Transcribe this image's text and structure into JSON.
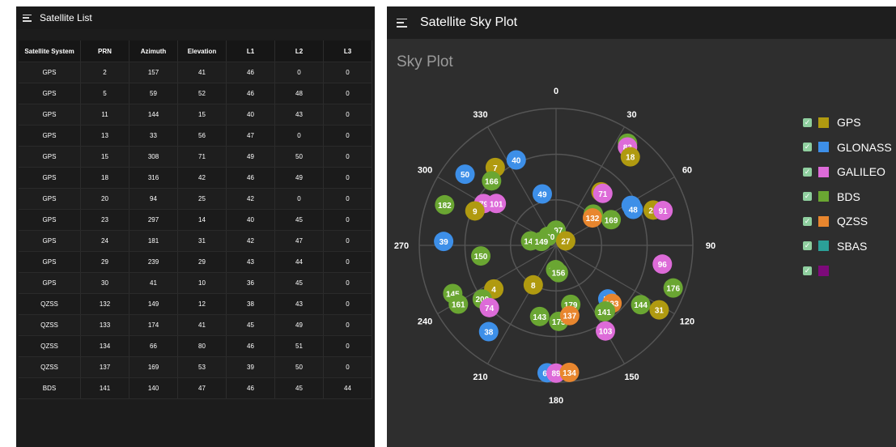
{
  "left": {
    "title": "Satellite List",
    "columns": [
      "Satellite System",
      "PRN",
      "Azimuth",
      "Elevation",
      "L1",
      "L2",
      "L3"
    ],
    "rows": [
      [
        "GPS",
        "2",
        "157",
        "41",
        "46",
        "0",
        "0"
      ],
      [
        "GPS",
        "5",
        "59",
        "52",
        "46",
        "48",
        "0"
      ],
      [
        "GPS",
        "11",
        "144",
        "15",
        "40",
        "43",
        "0"
      ],
      [
        "GPS",
        "13",
        "33",
        "56",
        "47",
        "0",
        "0"
      ],
      [
        "GPS",
        "15",
        "308",
        "71",
        "49",
        "50",
        "0"
      ],
      [
        "GPS",
        "18",
        "316",
        "42",
        "46",
        "49",
        "0"
      ],
      [
        "GPS",
        "20",
        "94",
        "25",
        "42",
        "0",
        "0"
      ],
      [
        "GPS",
        "23",
        "297",
        "14",
        "40",
        "45",
        "0"
      ],
      [
        "GPS",
        "24",
        "181",
        "31",
        "42",
        "47",
        "0"
      ],
      [
        "GPS",
        "29",
        "239",
        "29",
        "43",
        "44",
        "0"
      ],
      [
        "GPS",
        "30",
        "41",
        "10",
        "36",
        "45",
        "0"
      ],
      [
        "QZSS",
        "132",
        "149",
        "12",
        "38",
        "43",
        "0"
      ],
      [
        "QZSS",
        "133",
        "174",
        "41",
        "45",
        "49",
        "0"
      ],
      [
        "QZSS",
        "134",
        "66",
        "80",
        "46",
        "51",
        "0"
      ],
      [
        "QZSS",
        "137",
        "169",
        "53",
        "39",
        "50",
        "0"
      ],
      [
        "BDS",
        "141",
        "140",
        "47",
        "46",
        "45",
        "44"
      ]
    ]
  },
  "right": {
    "title": "Satellite Sky Plot",
    "plot_title": "Sky Plot",
    "legend": [
      {
        "name": "GPS",
        "color": "#b09a10"
      },
      {
        "name": "GLONASS",
        "color": "#3d8fe8"
      },
      {
        "name": "GALILEO",
        "color": "#dd6bd8"
      },
      {
        "name": "BDS",
        "color": "#6aa632"
      },
      {
        "name": "QZSS",
        "color": "#e8862e"
      },
      {
        "name": "SBAS",
        "color": "#2ba098"
      },
      {
        "name": "",
        "color": "#7d0a7a"
      }
    ]
  },
  "chart_data": {
    "type": "scatter",
    "projection": "polar-sky",
    "azimuth_labels": [
      "0",
      "30",
      "60",
      "90",
      "120",
      "150",
      "180",
      "210",
      "240",
      "270",
      "300",
      "330"
    ],
    "satellites": [
      {
        "prn": "197",
        "system": "BDS",
        "azimuth": 0,
        "elevation": 80
      },
      {
        "prn": "40",
        "system": "GLONASS",
        "azimuth": 335,
        "elevation": 28
      },
      {
        "prn": "49",
        "system": "GLONASS",
        "azimuth": 345,
        "elevation": 55
      },
      {
        "prn": "7",
        "system": "GPS",
        "azimuth": 322,
        "elevation": 25
      },
      {
        "prn": "166",
        "system": "BDS",
        "azimuth": 315,
        "elevation": 30
      },
      {
        "prn": "50",
        "system": "GLONASS",
        "azimuth": 308,
        "elevation": 14
      },
      {
        "prn": "83",
        "system": "BDS",
        "azimuth": 35,
        "elevation": 8
      },
      {
        "prn": "83",
        "system": "GALILEO",
        "azimuth": 36,
        "elevation": 10
      },
      {
        "prn": "18",
        "system": "GPS",
        "azimuth": 40,
        "elevation": 14
      },
      {
        "prn": "71",
        "system": "GPS",
        "azimuth": 40,
        "elevation": 44
      },
      {
        "prn": "71",
        "system": "GALILEO",
        "azimuth": 42,
        "elevation": 44
      },
      {
        "prn": "79",
        "system": "GALILEO",
        "azimuth": 300,
        "elevation": 35
      },
      {
        "prn": "101",
        "system": "GALILEO",
        "azimuth": 305,
        "elevation": 42
      },
      {
        "prn": "182",
        "system": "BDS",
        "azimuth": 290,
        "elevation": 12
      },
      {
        "prn": "9",
        "system": "GPS",
        "azimuth": 293,
        "elevation": 32
      },
      {
        "prn": "58",
        "system": "GLONASS",
        "azimuth": 62,
        "elevation": 34
      },
      {
        "prn": "48",
        "system": "GLONASS",
        "azimuth": 65,
        "elevation": 34
      },
      {
        "prn": "26",
        "system": "GPS",
        "azimuth": 70,
        "elevation": 22
      },
      {
        "prn": "91",
        "system": "GALILEO",
        "azimuth": 72,
        "elevation": 16
      },
      {
        "prn": "185",
        "system": "BDS",
        "azimuth": 50,
        "elevation": 58
      },
      {
        "prn": "132",
        "system": "QZSS",
        "azimuth": 53,
        "elevation": 60
      },
      {
        "prn": "169",
        "system": "BDS",
        "azimuth": 65,
        "elevation": 50
      },
      {
        "prn": "180",
        "system": "BDS",
        "azimuth": 318,
        "elevation": 82
      },
      {
        "prn": "147",
        "system": "BDS",
        "azimuth": 280,
        "elevation": 73
      },
      {
        "prn": "149",
        "system": "BDS",
        "azimuth": 285,
        "elevation": 80
      },
      {
        "prn": "27",
        "system": "GPS",
        "azimuth": 65,
        "elevation": 83
      },
      {
        "prn": "39",
        "system": "GLONASS",
        "azimuth": 272,
        "elevation": 16
      },
      {
        "prn": "150",
        "system": "BDS",
        "azimuth": 262,
        "elevation": 40
      },
      {
        "prn": "96",
        "system": "GALILEO",
        "azimuth": 100,
        "elevation": 19
      },
      {
        "prn": "176",
        "system": "BDS",
        "azimuth": 110,
        "elevation": 8
      },
      {
        "prn": "145",
        "system": "BDS",
        "azimuth": 245,
        "elevation": 15
      },
      {
        "prn": "4",
        "system": "GPS",
        "azimuth": 235,
        "elevation": 40
      },
      {
        "prn": "8",
        "system": "GPS",
        "azimuth": 210,
        "elevation": 60
      },
      {
        "prn": "141",
        "system": "BDS",
        "azimuth": 181,
        "elevation": 74
      },
      {
        "prn": "156",
        "system": "BDS",
        "azimuth": 175,
        "elevation": 72
      },
      {
        "prn": "179",
        "system": "BDS",
        "azimuth": 166,
        "elevation": 50
      },
      {
        "prn": "200",
        "system": "BDS",
        "azimuth": 234,
        "elevation": 30
      },
      {
        "prn": "74",
        "system": "GALILEO",
        "azimuth": 227,
        "elevation": 30
      },
      {
        "prn": "161",
        "system": "BDS",
        "azimuth": 239,
        "elevation": 15
      },
      {
        "prn": "143",
        "system": "BDS",
        "azimuth": 193,
        "elevation": 42
      },
      {
        "prn": "175",
        "system": "BDS",
        "azimuth": 178,
        "elevation": 40
      },
      {
        "prn": "137",
        "system": "QZSS",
        "azimuth": 169,
        "elevation": 43
      },
      {
        "prn": "59",
        "system": "GLONASS",
        "azimuth": 136,
        "elevation": 41
      },
      {
        "prn": "133",
        "system": "QZSS",
        "azimuth": 136,
        "elevation": 37
      },
      {
        "prn": "199",
        "system": "BDS",
        "azimuth": 143,
        "elevation": 36
      },
      {
        "prn": "141",
        "system": "BDS",
        "azimuth": 144,
        "elevation": 36
      },
      {
        "prn": "144",
        "system": "BDS",
        "azimuth": 125,
        "elevation": 22
      },
      {
        "prn": "31",
        "system": "GPS",
        "azimuth": 122,
        "elevation": 10
      },
      {
        "prn": "103",
        "system": "GALILEO",
        "azimuth": 150,
        "elevation": 25
      },
      {
        "prn": "38",
        "system": "GLONASS",
        "azimuth": 218,
        "elevation": 18
      },
      {
        "prn": "60",
        "system": "GLONASS",
        "azimuth": 184,
        "elevation": 6
      },
      {
        "prn": "89",
        "system": "GALILEO",
        "azimuth": 180,
        "elevation": 6
      },
      {
        "prn": "134",
        "system": "QZSS",
        "azimuth": 174,
        "elevation": 6
      }
    ]
  }
}
